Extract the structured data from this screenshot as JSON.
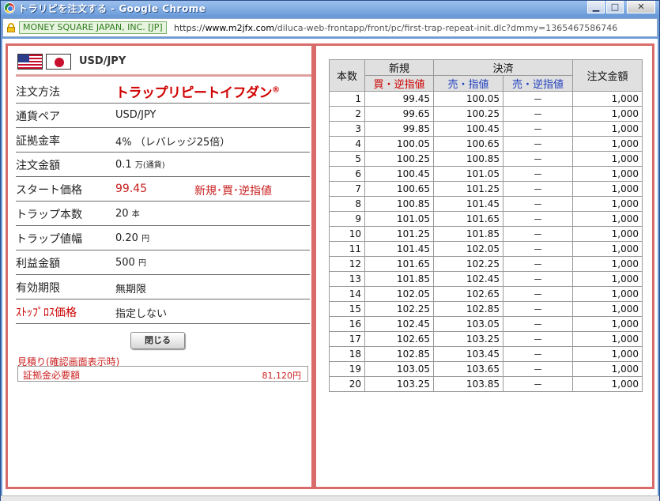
{
  "window": {
    "title": "トラリピを注文する - Google Chrome",
    "min_label": "0",
    "max_label": "1",
    "close_label": "r"
  },
  "address_bar": {
    "ev_label": "MONEY SQUARE JAPAN, INC. [JP]",
    "url_scheme": "https://",
    "url_domain": "www.m2jfx.com",
    "url_path": "/diluca-web-frontapp/front/pc/first-trap-repeat-init.dlc?dmmy=1365467586746"
  },
  "pair": {
    "label": "USD/JPY"
  },
  "order": {
    "rows": [
      {
        "key": "注文方法",
        "value": "トラップリピートイフダン",
        "value_mark": "®"
      },
      {
        "key": "通貨ペア",
        "value": "USD/JPY"
      },
      {
        "key": "証拠金率",
        "value": "4%",
        "value_extra": "（レバレッジ25倍）"
      },
      {
        "key": "注文金額",
        "value": "0.1",
        "unit": "万(通貨)"
      },
      {
        "key": "スタート価格",
        "value": "99.45",
        "value_extra": "新規･買･逆指値"
      },
      {
        "key": "トラップ本数",
        "value": "20",
        "unit": "本"
      },
      {
        "key": "トラップ値幅",
        "value": "0.20",
        "unit": "円"
      },
      {
        "key": "利益金額",
        "value": "500",
        "unit": "円"
      },
      {
        "key": "有効期限",
        "value": "無期限"
      },
      {
        "key": "ｽﾄｯﾌﾟﾛｽ価格",
        "value": "指定しない"
      }
    ],
    "close_button": "閉じる",
    "estimate_title": "見積り(確認画面表示時)",
    "margin_label": "証拠金必要額",
    "margin_value": "81,120円"
  },
  "table": {
    "headers": {
      "count": "本数",
      "new": "新規",
      "settle": "決済",
      "amount": "注文金額",
      "new_sub": "買・逆指値",
      "settle_sub1": "売・指値",
      "settle_sub2": "売・逆指値"
    },
    "rows": [
      {
        "n": "1",
        "new": "99.45",
        "settle": "100.05",
        "stop": "－",
        "amount": "1,000"
      },
      {
        "n": "2",
        "new": "99.65",
        "settle": "100.25",
        "stop": "－",
        "amount": "1,000"
      },
      {
        "n": "3",
        "new": "99.85",
        "settle": "100.45",
        "stop": "－",
        "amount": "1,000"
      },
      {
        "n": "4",
        "new": "100.05",
        "settle": "100.65",
        "stop": "－",
        "amount": "1,000"
      },
      {
        "n": "5",
        "new": "100.25",
        "settle": "100.85",
        "stop": "－",
        "amount": "1,000"
      },
      {
        "n": "6",
        "new": "100.45",
        "settle": "101.05",
        "stop": "－",
        "amount": "1,000"
      },
      {
        "n": "7",
        "new": "100.65",
        "settle": "101.25",
        "stop": "－",
        "amount": "1,000"
      },
      {
        "n": "8",
        "new": "100.85",
        "settle": "101.45",
        "stop": "－",
        "amount": "1,000"
      },
      {
        "n": "9",
        "new": "101.05",
        "settle": "101.65",
        "stop": "－",
        "amount": "1,000"
      },
      {
        "n": "10",
        "new": "101.25",
        "settle": "101.85",
        "stop": "－",
        "amount": "1,000"
      },
      {
        "n": "11",
        "new": "101.45",
        "settle": "102.05",
        "stop": "－",
        "amount": "1,000"
      },
      {
        "n": "12",
        "new": "101.65",
        "settle": "102.25",
        "stop": "－",
        "amount": "1,000"
      },
      {
        "n": "13",
        "new": "101.85",
        "settle": "102.45",
        "stop": "－",
        "amount": "1,000"
      },
      {
        "n": "14",
        "new": "102.05",
        "settle": "102.65",
        "stop": "－",
        "amount": "1,000"
      },
      {
        "n": "15",
        "new": "102.25",
        "settle": "102.85",
        "stop": "－",
        "amount": "1,000"
      },
      {
        "n": "16",
        "new": "102.45",
        "settle": "103.05",
        "stop": "－",
        "amount": "1,000"
      },
      {
        "n": "17",
        "new": "102.65",
        "settle": "103.25",
        "stop": "－",
        "amount": "1,000"
      },
      {
        "n": "18",
        "new": "102.85",
        "settle": "103.45",
        "stop": "－",
        "amount": "1,000"
      },
      {
        "n": "19",
        "new": "103.05",
        "settle": "103.65",
        "stop": "－",
        "amount": "1,000"
      },
      {
        "n": "20",
        "new": "103.25",
        "settle": "103.85",
        "stop": "－",
        "amount": "1,000"
      }
    ]
  },
  "colors": {
    "panel_border": "#d96b6b",
    "brand_red": "#d00000",
    "header_red": "#cc0000",
    "header_blue": "#1f3fbf"
  }
}
